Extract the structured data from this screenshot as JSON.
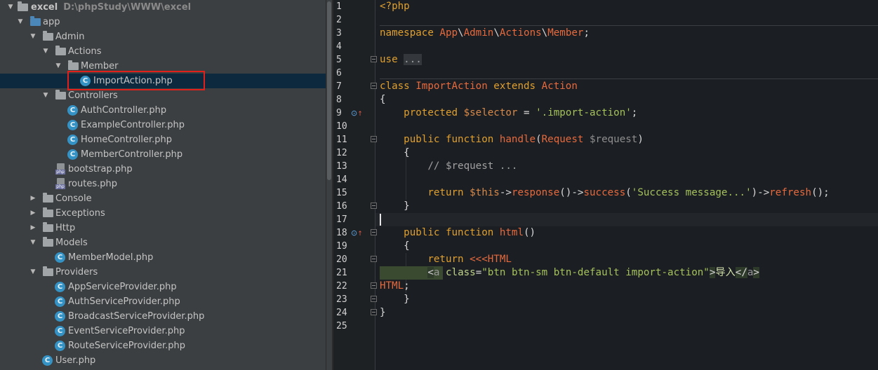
{
  "tree": {
    "rows": [
      {
        "label": "excel",
        "path": "D:\\phpStudy\\WWW\\excel"
      },
      {
        "label": "app"
      },
      {
        "label": "Admin"
      },
      {
        "label": "Actions"
      },
      {
        "label": "Member"
      },
      {
        "label": "ImportAction.php"
      },
      {
        "label": "Controllers"
      },
      {
        "label": "AuthController.php"
      },
      {
        "label": "ExampleController.php"
      },
      {
        "label": "HomeController.php"
      },
      {
        "label": "MemberController.php"
      },
      {
        "label": "bootstrap.php"
      },
      {
        "label": "routes.php"
      },
      {
        "label": "Console"
      },
      {
        "label": "Exceptions"
      },
      {
        "label": "Http"
      },
      {
        "label": "Models"
      },
      {
        "label": "MemberModel.php"
      },
      {
        "label": "Providers"
      },
      {
        "label": "AppServiceProvider.php"
      },
      {
        "label": "AuthServiceProvider.php"
      },
      {
        "label": "BroadcastServiceProvider.php"
      },
      {
        "label": "EventServiceProvider.php"
      },
      {
        "label": "RouteServiceProvider.php"
      },
      {
        "label": "User.php"
      }
    ],
    "class_glyph": "C",
    "php_glyph": "php",
    "expanded_arrow": "▼",
    "collapsed_arrow": "▶"
  },
  "editor": {
    "line_numbers": [
      "1",
      "2",
      "3",
      "4",
      "5",
      "6",
      "7",
      "8",
      "9",
      "10",
      "11",
      "12",
      "13",
      "14",
      "15",
      "16",
      "17",
      "18",
      "19",
      "20",
      "21",
      "22",
      "23",
      "24",
      "25"
    ],
    "override_marker": "⊙",
    "override_arrow": "↑",
    "code": {
      "l1": {
        "t1": "<?php"
      },
      "l3": {
        "t1": "namespace ",
        "t2": "App",
        "t3": "\\",
        "t4": "Admin",
        "t5": "\\",
        "t6": "Actions",
        "t7": "\\",
        "t8": "Member",
        "t9": ";"
      },
      "l5": {
        "t1": "use ",
        "t2": "..."
      },
      "l8": {
        "t1": "class ",
        "t2": "ImportAction ",
        "t3": "extends ",
        "t4": "Action"
      },
      "l9": {
        "t1": "{"
      },
      "l10": {
        "t1": "    protected ",
        "t2": "$selector ",
        "t3": "= ",
        "t4": "'.import-action'",
        "t5": ";"
      },
      "l12": {
        "t1": "    public function ",
        "t2": "handle",
        "t3": "(",
        "t4": "Request ",
        "t5": "$request",
        "t6": ")"
      },
      "l13": {
        "t1": "    {"
      },
      "l14": {
        "t1": "        // $request ..."
      },
      "l16": {
        "t1": "        return ",
        "t2": "$this",
        "t3": "->",
        "t4": "response",
        "t5": "()->",
        "t6": "success",
        "t7": "(",
        "t8": "'Success message...'",
        "t9": ")->",
        "t10": "refresh",
        "t11": "();"
      },
      "l17": {
        "t1": "    }"
      },
      "l19": {
        "t1": "    public function ",
        "t2": "html",
        "t3": "()"
      },
      "l20": {
        "t1": "    {"
      },
      "l21": {
        "t1": "        return ",
        "t2": "<<<HTML"
      },
      "l22": {
        "t1": "        ",
        "t2": "<",
        "t3": "a ",
        "t4": "class",
        "t5": "=",
        "t6": "\"btn btn-sm btn-default import-action\"",
        "t7": ">",
        "t8": "导入",
        "t9": "</",
        "t10": "a",
        "t11": ">"
      },
      "l23": {
        "t1": "HTML",
        "t2": ";"
      },
      "l24": {
        "t1": "    }"
      },
      "l25": {
        "t1": "}"
      }
    }
  }
}
